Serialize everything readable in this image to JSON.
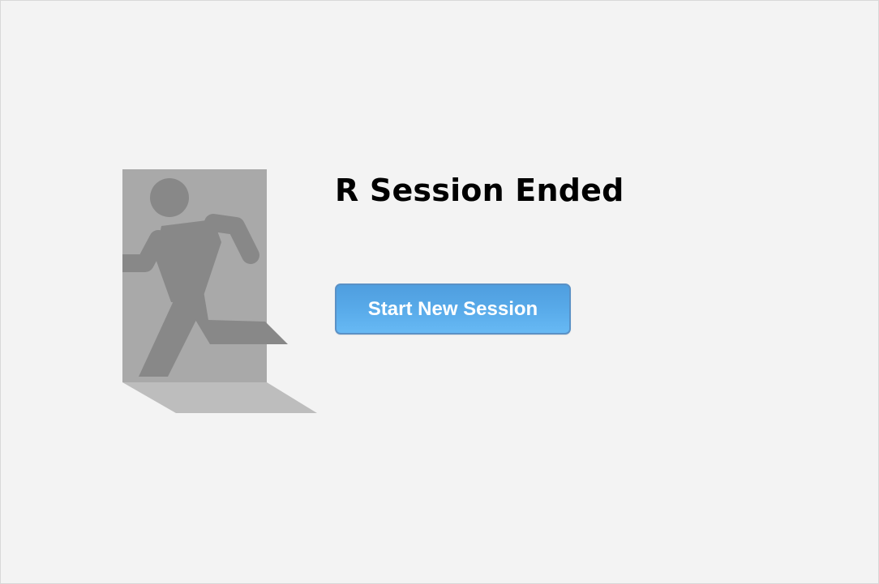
{
  "dialog": {
    "title": "R Session Ended",
    "button_label": "Start New Session",
    "illustration_icon": "exit-running-man-icon"
  },
  "colors": {
    "background": "#f3f3f3",
    "door": "#a9a9a9",
    "figure": "#888888",
    "shadow": "#bdbdbd",
    "button_top": "#4f9edf",
    "button_bottom": "#67b9f4",
    "button_border": "#5a91c6",
    "button_text": "#ffffff"
  }
}
